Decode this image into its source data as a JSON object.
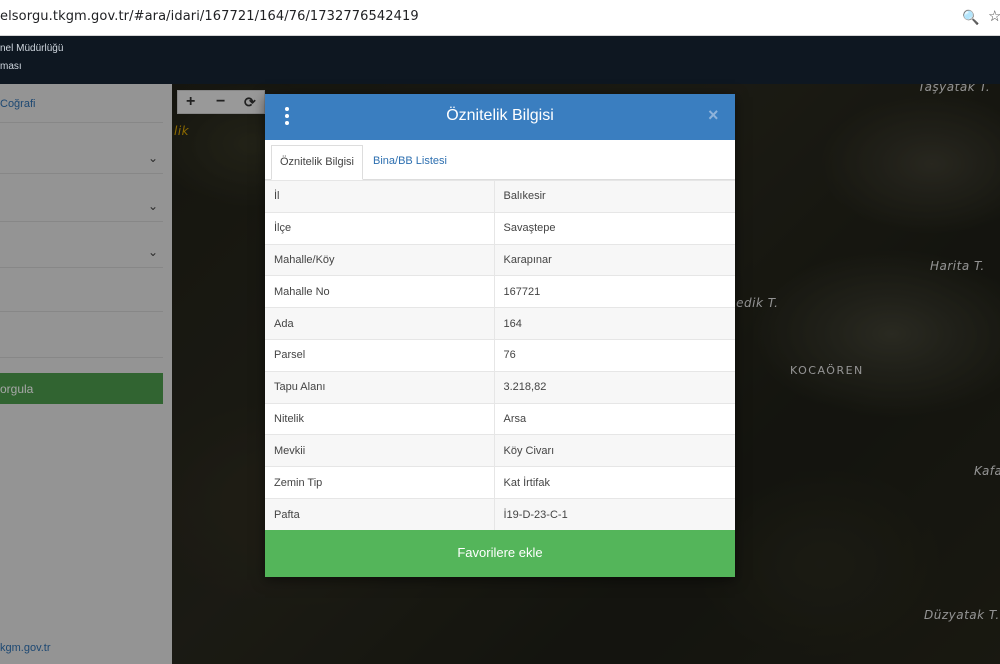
{
  "browser": {
    "url": "elsorgu.tkgm.gov.tr/#ara/idari/167721/164/76/1732776542419",
    "zoom_icon": "zoom-icon",
    "star_icon": "star-icon"
  },
  "header": {
    "line1": "nel Müdürlüğü",
    "line2": "ması"
  },
  "sidebar": {
    "link": "Coğrafi",
    "button": "orgula",
    "footer": "kgm.gov.tr"
  },
  "map": {
    "controls": [
      "+",
      "−",
      "⟳"
    ],
    "labels": [
      "Taşyatak T.",
      "Harita T.",
      "gedik T.",
      "KOCAÖREN",
      "Kafa",
      "Düzyatak T.",
      "lik"
    ]
  },
  "modal": {
    "title": "Öznitelik Bilgisi",
    "close": "×",
    "tabs": [
      "Öznitelik Bilgisi",
      "Bina/BB Listesi"
    ],
    "rows": [
      {
        "key": "İl",
        "value": "Balıkesir"
      },
      {
        "key": "İlçe",
        "value": "Savaştepe"
      },
      {
        "key": "Mahalle/Köy",
        "value": "Karapınar"
      },
      {
        "key": "Mahalle No",
        "value": "167721"
      },
      {
        "key": "Ada",
        "value": "164"
      },
      {
        "key": "Parsel",
        "value": "76"
      },
      {
        "key": "Tapu Alanı",
        "value": "3.218,82"
      },
      {
        "key": "Nitelik",
        "value": "Arsa"
      },
      {
        "key": "Mevkii",
        "value": "Köy Civarı"
      },
      {
        "key": "Zemin Tip",
        "value": "Kat İrtifak"
      },
      {
        "key": "Pafta",
        "value": "İ19-D-23-C-1"
      }
    ],
    "favorite_button": "Favorilere ekle"
  }
}
